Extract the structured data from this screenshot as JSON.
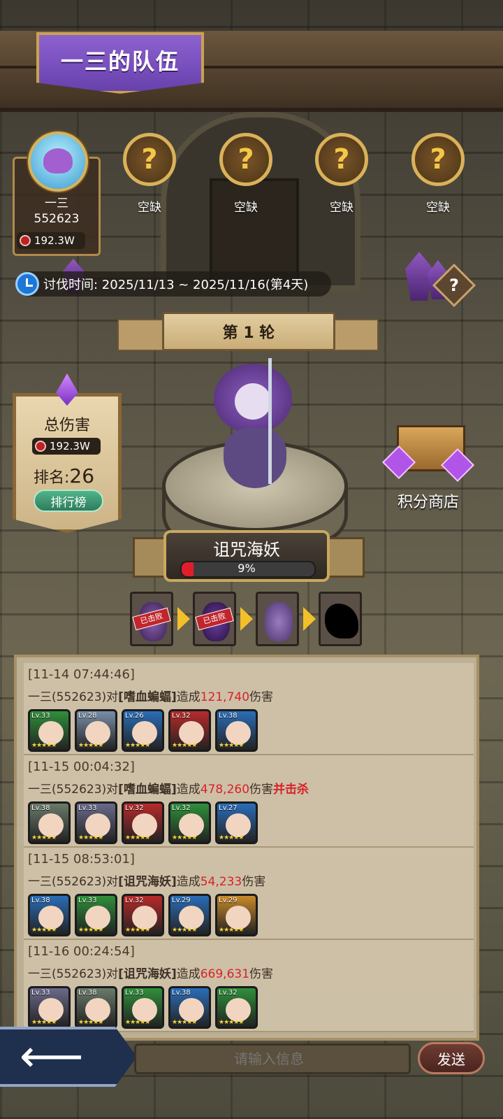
{
  "team": {
    "title": "一三的队伍"
  },
  "player": {
    "name": "一三",
    "id": "552623",
    "damage": "192.3W"
  },
  "slots": [
    {
      "label": "空缺",
      "icon": "question-icon"
    },
    {
      "label": "空缺",
      "icon": "question-icon"
    },
    {
      "label": "空缺",
      "icon": "question-icon"
    },
    {
      "label": "空缺",
      "icon": "question-icon"
    }
  ],
  "event": {
    "time_text": "讨伐时间: 2025/11/13 ~ 2025/11/16(第4天)",
    "round": "第 1 轮"
  },
  "damage_panel": {
    "title": "总伤害",
    "damage": "192.3W",
    "rank_label": "排名:",
    "rank": "26",
    "ranking_button": "排行榜"
  },
  "shop": {
    "label": "积分商店"
  },
  "boss": {
    "name": "诅咒海妖",
    "hp_text": "9%",
    "hp_fraction": 0.09
  },
  "stages": [
    {
      "stamp": "已击败",
      "state": "defeated"
    },
    {
      "stamp": "已击败",
      "state": "defeated"
    },
    {
      "stamp": "",
      "state": "current"
    },
    {
      "stamp": "",
      "state": "locked"
    }
  ],
  "logs": [
    {
      "time": "[11-14 07:44:46]",
      "player": "一三(552623)对",
      "target": "[嗜血蝙蝠]",
      "mid": "造成",
      "damage": "121,740",
      "suffix": "伤害",
      "kill": "",
      "heroes": [
        {
          "lv": "Lv.33",
          "color": "#2f8f3a"
        },
        {
          "lv": "Lv.28",
          "color": "#7a8ea8"
        },
        {
          "lv": "Lv.26",
          "color": "#2a6db8"
        },
        {
          "lv": "Lv.32",
          "color": "#b82a2a"
        },
        {
          "lv": "Lv.38",
          "color": "#2a6db8"
        }
      ]
    },
    {
      "time": "[11-15 00:04:32]",
      "player": "一三(552623)对",
      "target": "[嗜血蝙蝠]",
      "mid": "造成",
      "damage": "478,260",
      "suffix": "伤害",
      "kill": "并击杀",
      "heroes": [
        {
          "lv": "Lv.38",
          "color": "#6a7a6a"
        },
        {
          "lv": "Lv.33",
          "color": "#6a6a8a"
        },
        {
          "lv": "Lv.32",
          "color": "#b82a2a"
        },
        {
          "lv": "Lv.32",
          "color": "#2f8f3a"
        },
        {
          "lv": "Lv.27",
          "color": "#2a6db8"
        }
      ]
    },
    {
      "time": "[11-15 08:53:01]",
      "player": "一三(552623)对",
      "target": "[诅咒海妖]",
      "mid": "造成",
      "damage": "54,233",
      "suffix": "伤害",
      "kill": "",
      "heroes": [
        {
          "lv": "Lv.38",
          "color": "#2a6db8"
        },
        {
          "lv": "Lv.33",
          "color": "#2f8f3a"
        },
        {
          "lv": "Lv.32",
          "color": "#b82a2a"
        },
        {
          "lv": "Lv.29",
          "color": "#2a6db8"
        },
        {
          "lv": "Lv.29",
          "color": "#c98a2a"
        }
      ]
    },
    {
      "time": "[11-16 00:24:54]",
      "player": "一三(552623)对",
      "target": "[诅咒海妖]",
      "mid": "造成",
      "damage": "669,631",
      "suffix": "伤害",
      "kill": "",
      "heroes": [
        {
          "lv": "Lv.33",
          "color": "#6a6a8a"
        },
        {
          "lv": "Lv.38",
          "color": "#6a7a6a"
        },
        {
          "lv": "Lv.33",
          "color": "#2f8f3a"
        },
        {
          "lv": "Lv.38",
          "color": "#2a6db8"
        },
        {
          "lv": "Lv.32",
          "color": "#2f8f3a"
        }
      ]
    }
  ],
  "hero_stars": "★★★★★",
  "chat": {
    "placeholder": "请输入信息",
    "send": "发送"
  },
  "colors": {
    "accent_purple": "#7b4fc2",
    "damage_red": "#d8222a",
    "gold": "#d9b259"
  }
}
